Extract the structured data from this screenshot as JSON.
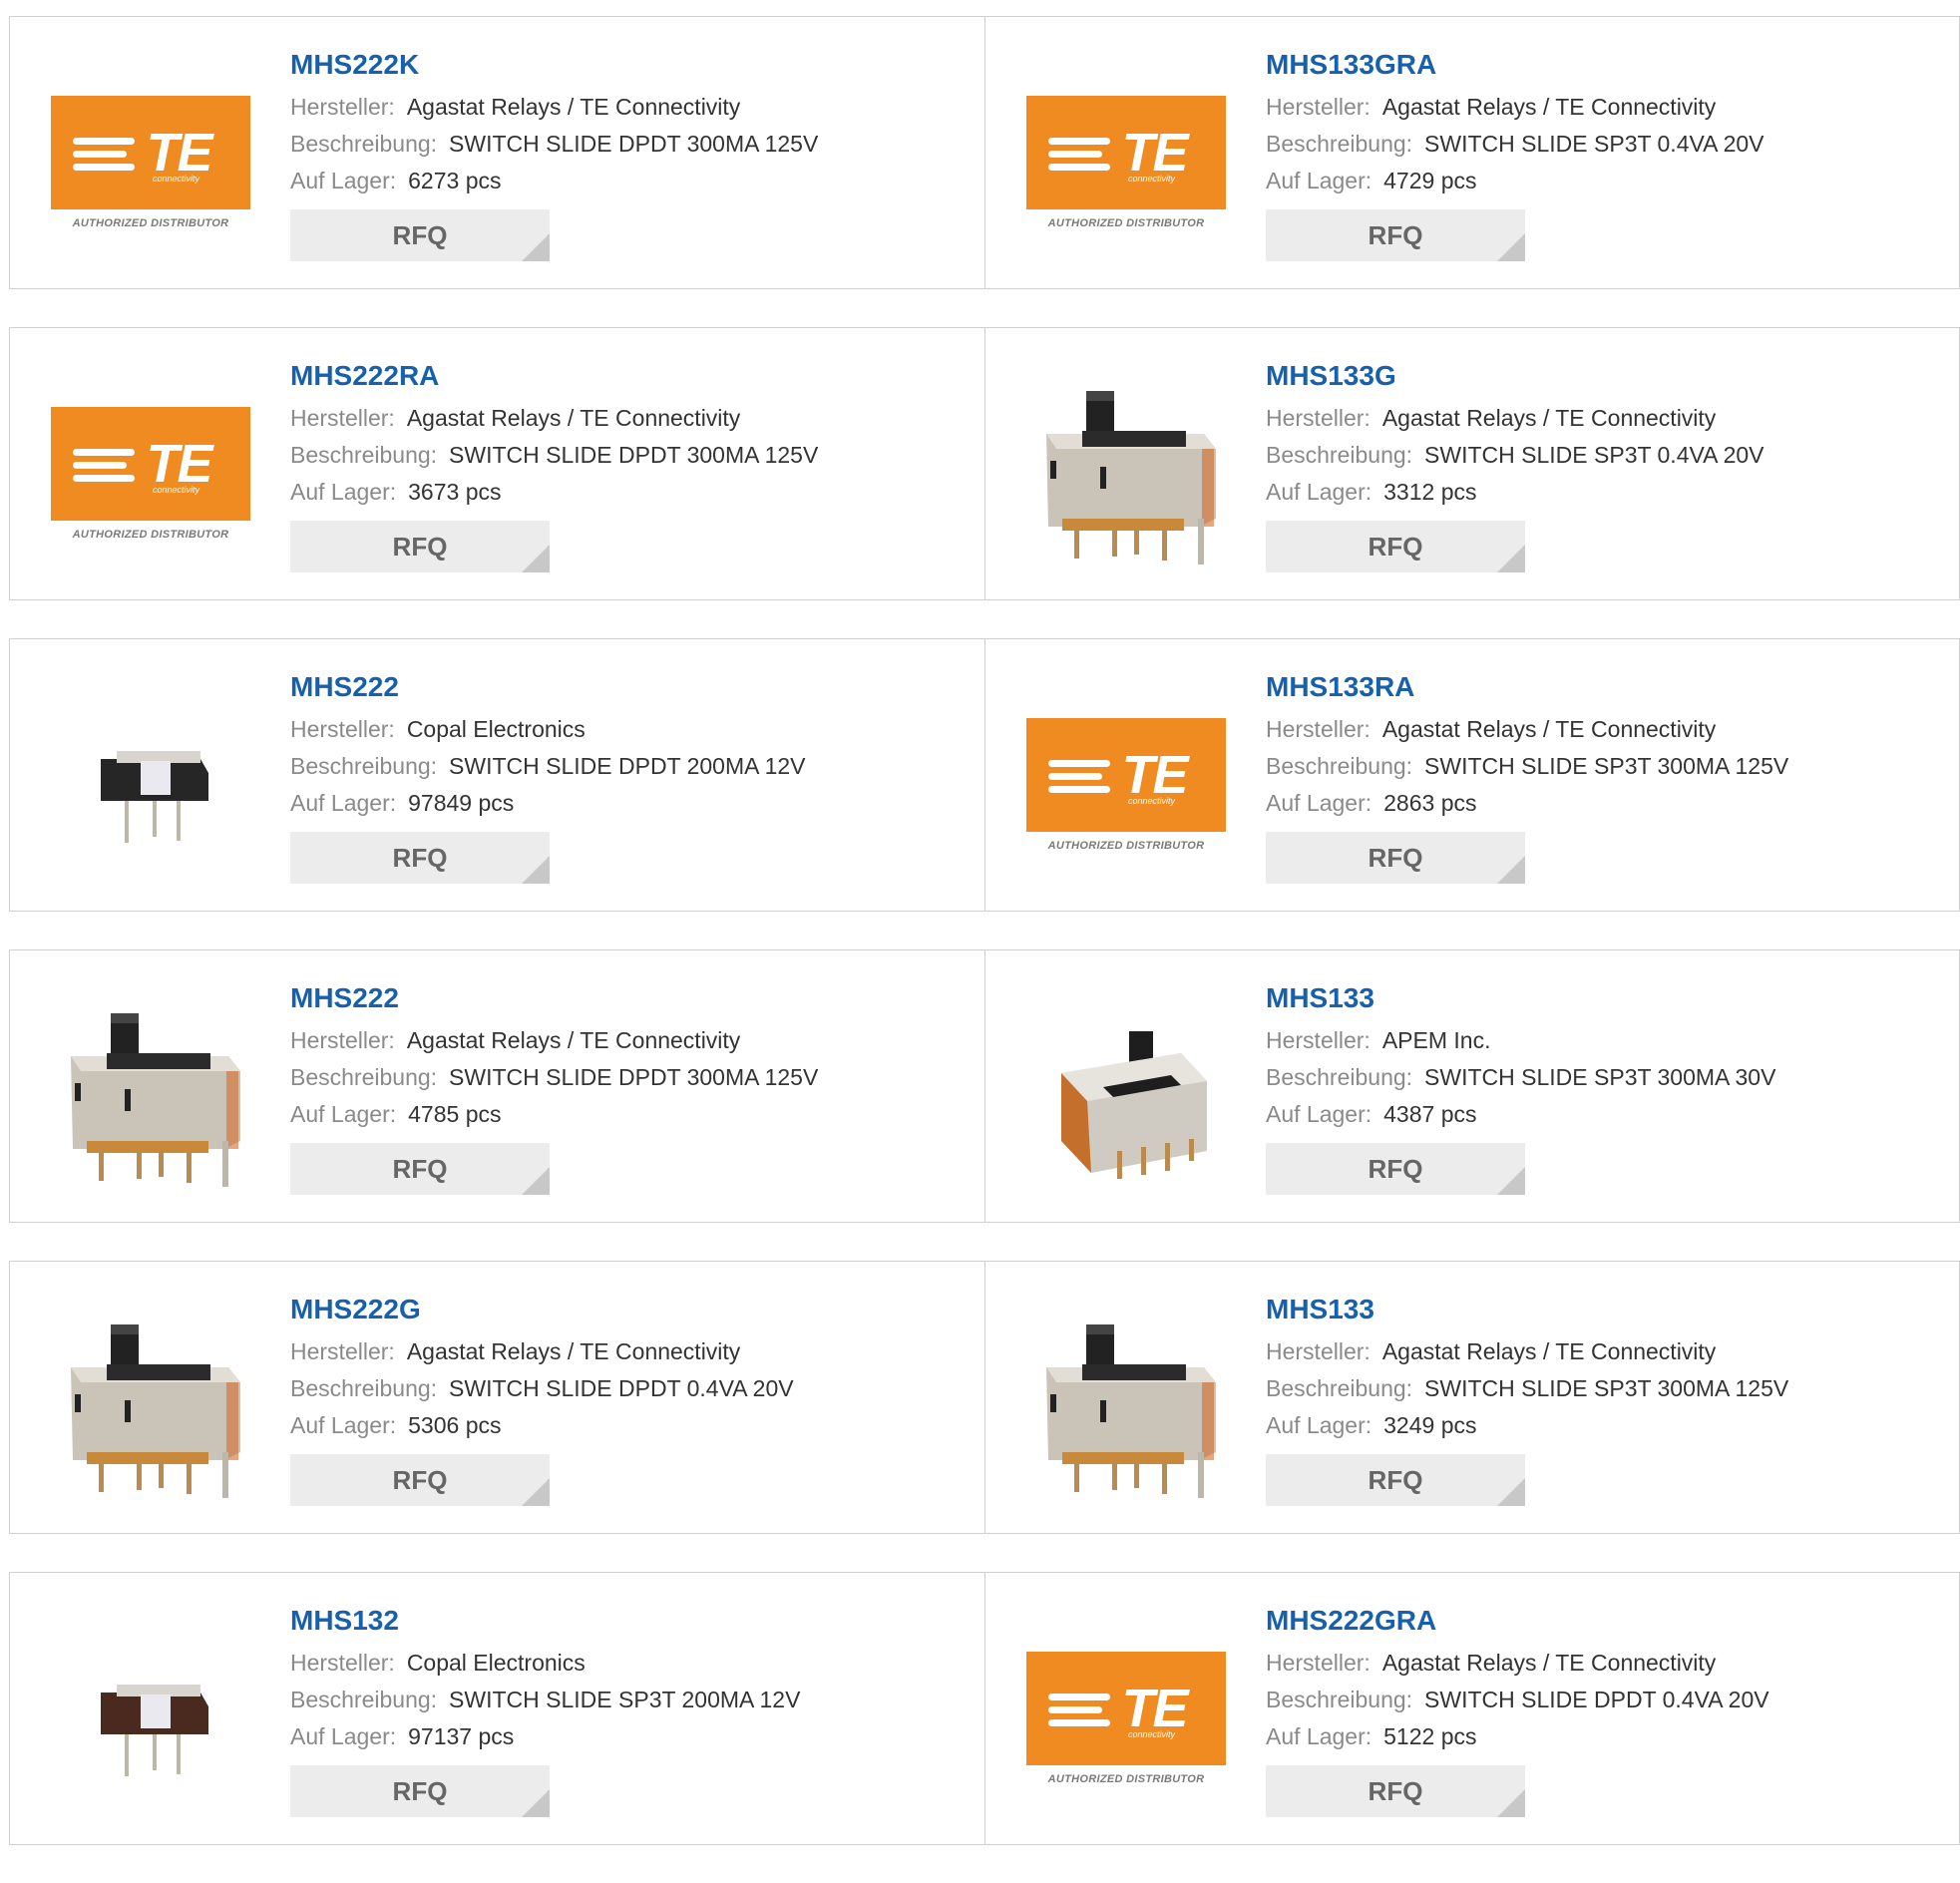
{
  "labels": {
    "manufacturer": "Hersteller:",
    "description": "Beschreibung:",
    "stock": "Auf Lager:",
    "rfq": "RFQ"
  },
  "logo": {
    "brand": "TE",
    "sub": "connectivity",
    "authorized": "AUTHORIZED DISTRIBUTOR",
    "color": "#f08b22"
  },
  "rows": [
    [
      {
        "name": "MHS222K",
        "manufacturer": "Agastat Relays / TE Connectivity",
        "description": "SWITCH SLIDE DPDT 300MA 125V",
        "stock": "6273 pcs",
        "image": "te-logo"
      },
      {
        "name": "MHS133GRA",
        "manufacturer": "Agastat Relays / TE Connectivity",
        "description": "SWITCH SLIDE SP3T 0.4VA 20V",
        "stock": "4729 pcs",
        "image": "te-logo"
      }
    ],
    [
      {
        "name": "MHS222RA",
        "manufacturer": "Agastat Relays / TE Connectivity",
        "description": "SWITCH SLIDE DPDT 300MA 125V",
        "stock": "3673 pcs",
        "image": "te-logo"
      },
      {
        "name": "MHS133G",
        "manufacturer": "Agastat Relays / TE Connectivity",
        "description": "SWITCH SLIDE SP3T 0.4VA 20V",
        "stock": "3312 pcs",
        "image": "slide-switch-large"
      }
    ],
    [
      {
        "name": "MHS222",
        "manufacturer": "Copal Electronics",
        "description": "SWITCH SLIDE DPDT 200MA 12V",
        "stock": "97849 pcs",
        "image": "slide-switch-small-black"
      },
      {
        "name": "MHS133RA",
        "manufacturer": "Agastat Relays / TE Connectivity",
        "description": "SWITCH SLIDE SP3T 300MA 125V",
        "stock": "2863 pcs",
        "image": "te-logo"
      }
    ],
    [
      {
        "name": "MHS222",
        "manufacturer": "Agastat Relays / TE Connectivity",
        "description": "SWITCH SLIDE DPDT 300MA 125V",
        "stock": "4785 pcs",
        "image": "slide-switch-large"
      },
      {
        "name": "MHS133",
        "manufacturer": "APEM Inc.",
        "description": "SWITCH SLIDE SP3T 300MA 30V",
        "stock": "4387 pcs",
        "image": "slide-switch-apem"
      }
    ],
    [
      {
        "name": "MHS222G",
        "manufacturer": "Agastat Relays / TE Connectivity",
        "description": "SWITCH SLIDE DPDT 0.4VA 20V",
        "stock": "5306 pcs",
        "image": "slide-switch-large"
      },
      {
        "name": "MHS133",
        "manufacturer": "Agastat Relays / TE Connectivity",
        "description": "SWITCH SLIDE SP3T 300MA 125V",
        "stock": "3249 pcs",
        "image": "slide-switch-large"
      }
    ],
    [
      {
        "name": "MHS132",
        "manufacturer": "Copal Electronics",
        "description": "SWITCH SLIDE SP3T 200MA 12V",
        "stock": "97137 pcs",
        "image": "slide-switch-small-brown"
      },
      {
        "name": "MHS222GRA",
        "manufacturer": "Agastat Relays / TE Connectivity",
        "description": "SWITCH SLIDE DPDT 0.4VA 20V",
        "stock": "5122 pcs",
        "image": "te-logo"
      }
    ]
  ]
}
